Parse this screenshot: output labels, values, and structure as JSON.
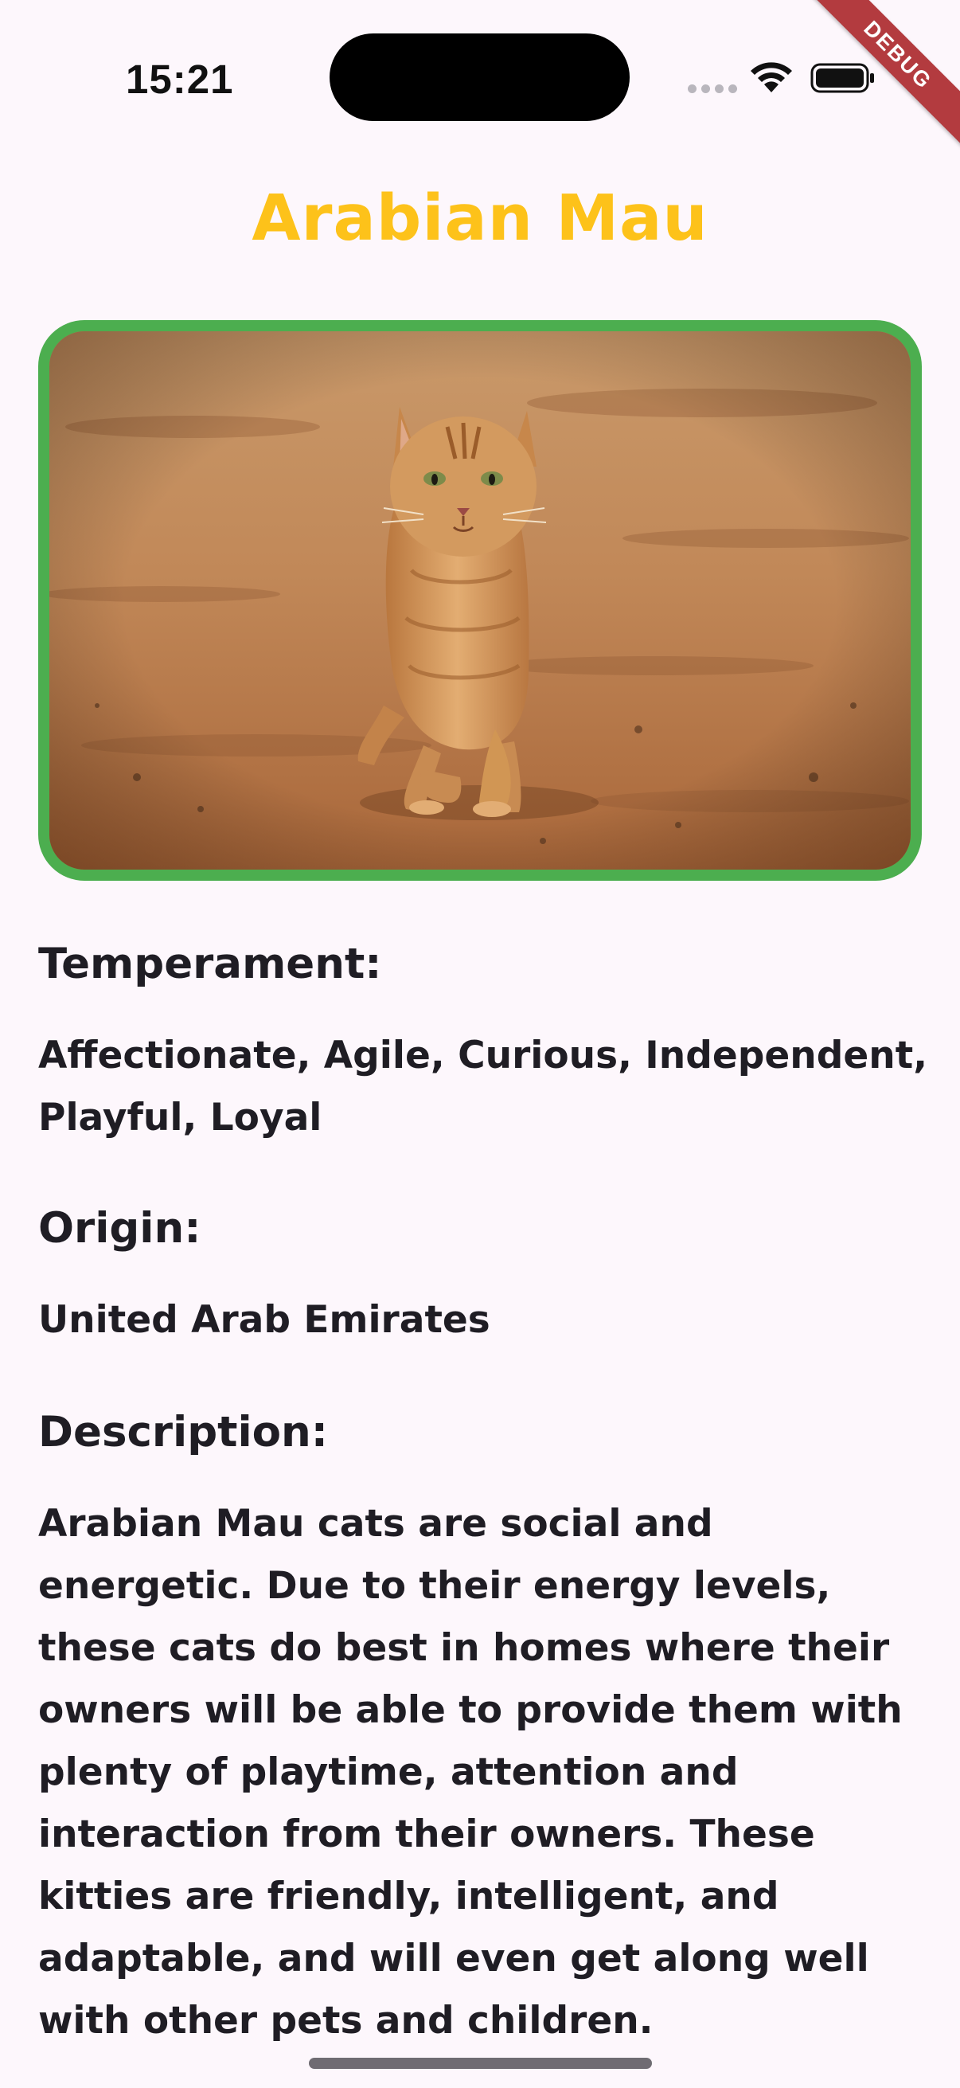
{
  "status_bar": {
    "time": "15:21",
    "debug_label": "DEBUG"
  },
  "breed": {
    "title": "Arabian Mau",
    "image_alt": "Orange tabby cat walking on a dirt path"
  },
  "sections": {
    "temperament": {
      "heading": "Temperament:",
      "body": "Affectionate, Agile, Curious, Independent, Playful, Loyal"
    },
    "origin": {
      "heading": "Origin:",
      "body": "United Arab Emirates"
    },
    "description": {
      "heading": "Description:",
      "body": "Arabian Mau cats are social and energetic. Due to their energy levels, these cats do best in homes where their owners will be able to provide them with plenty of playtime, attention and interaction from their owners. These kitties are friendly, intelligent, and adaptable, and will even get along well with other pets and children."
    }
  },
  "colors": {
    "title": "#fdc21a",
    "frame_border": "#4cae4f",
    "background": "#fdf7fc",
    "text": "#1f1d24"
  },
  "icons": {
    "wifi": "wifi-icon",
    "battery": "battery-icon"
  }
}
